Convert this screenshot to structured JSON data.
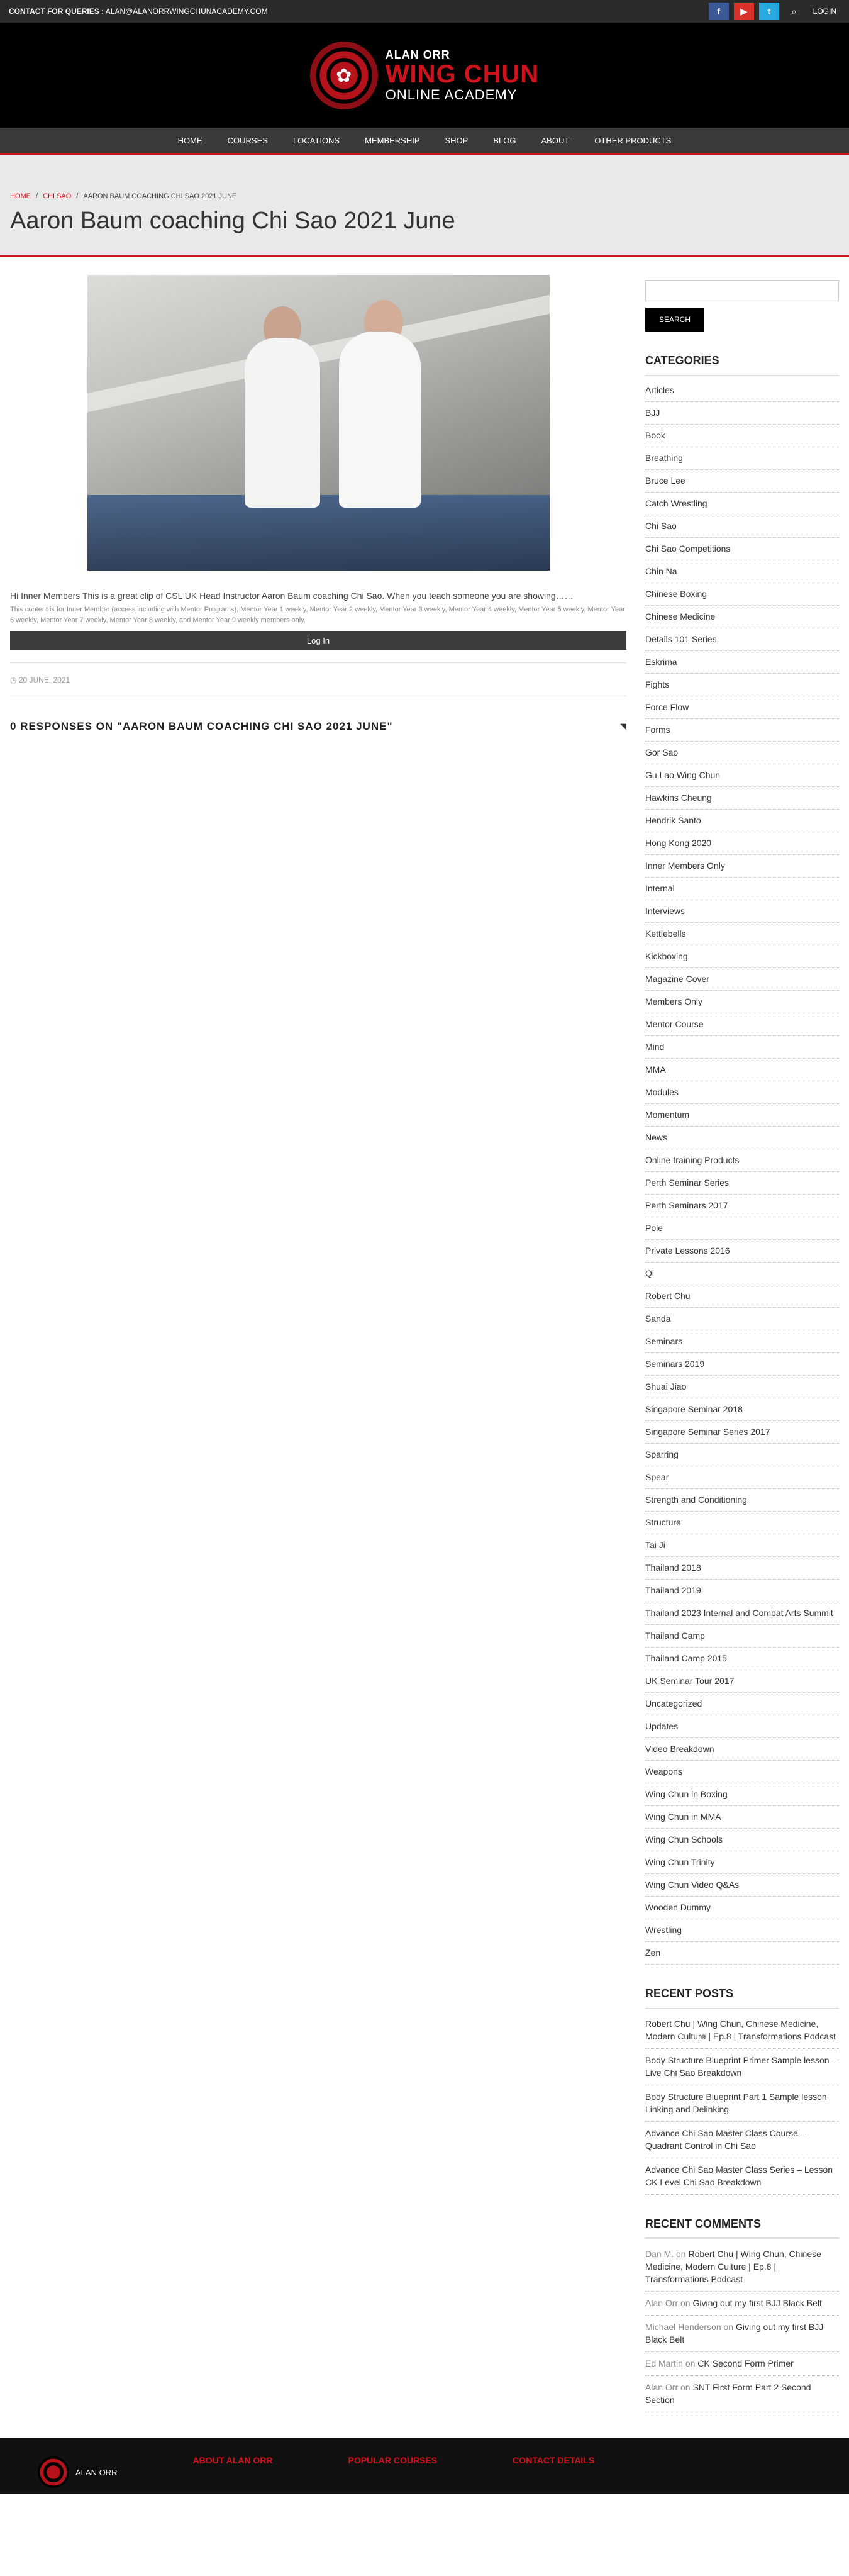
{
  "topbar": {
    "contact_label": "CONTACT FOR QUERIES :",
    "contact_email": "ALAN@ALANORRWINGCHUNACADEMY.COM",
    "login": "LOGIN"
  },
  "logo": {
    "line1": "ALAN ORR",
    "line2": "WING CHUN",
    "line3": "ONLINE ACADEMY"
  },
  "nav": [
    "HOME",
    "COURSES",
    "LOCATIONS",
    "MEMBERSHIP",
    "SHOP",
    "BLOG",
    "ABOUT",
    "OTHER PRODUCTS"
  ],
  "breadcrumb": [
    "HOME",
    "CHI SAO",
    "AARON BAUM COACHING CHI SAO 2021 JUNE"
  ],
  "page_title": "Aaron Baum coaching Chi Sao 2021 June",
  "post": {
    "excerpt": "Hi Inner Members This is a great clip of CSL UK Head Instructor Aaron Baum coaching Chi Sao. When you teach someone you are showing……",
    "members_note": "This content is for Inner Member (access including with Mentor Programs), Mentor Year 1 weekly, Mentor Year 2 weekly, Mentor Year 3 weekly, Mentor Year 4 weekly, Mentor Year 5 weekly, Mentor Year 6 weekly, Mentor Year 7 weekly, Mentor Year 8 weekly, and Mentor Year 9 weekly members only.",
    "login_button": "Log In",
    "date": "20 JUNE, 2021",
    "responses_title": "0 RESPONSES ON \"AARON BAUM COACHING CHI SAO 2021 JUNE\""
  },
  "sidebar": {
    "search_button": "SEARCH",
    "categories_title": "CATEGORIES",
    "categories": [
      "Articles",
      "BJJ",
      "Book",
      "Breathing",
      "Bruce Lee",
      "Catch Wrestling",
      "Chi Sao",
      "Chi Sao Competitions",
      "Chin Na",
      "Chinese Boxing",
      "Chinese Medicine",
      "Details 101 Series",
      "Eskrima",
      "Fights",
      "Force Flow",
      "Forms",
      "Gor Sao",
      "Gu Lao Wing Chun",
      "Hawkins Cheung",
      "Hendrik Santo",
      "Hong Kong 2020",
      "Inner Members Only",
      "Internal",
      "Interviews",
      "Kettlebells",
      "Kickboxing",
      "Magazine Cover",
      "Members Only",
      "Mentor Course",
      "Mind",
      "MMA",
      "Modules",
      "Momentum",
      "News",
      "Online training Products",
      "Perth Seminar Series",
      "Perth Seminars 2017",
      "Pole",
      "Private Lessons 2016",
      "Qi",
      "Robert Chu",
      "Sanda",
      "Seminars",
      "Seminars 2019",
      "Shuai Jiao",
      "Singapore Seminar 2018",
      "Singapore Seminar Series 2017",
      "Sparring",
      "Spear",
      "Strength and Conditioning",
      "Structure",
      "Tai Ji",
      "Thailand 2018",
      "Thailand 2019",
      "Thailand 2023 Internal and Combat Arts Summit",
      "Thailand Camp",
      "Thailand Camp 2015",
      "UK Seminar Tour 2017",
      "Uncategorized",
      "Updates",
      "Video Breakdown",
      "Weapons",
      "Wing Chun in Boxing",
      "Wing Chun in MMA",
      "Wing Chun Schools",
      "Wing Chun Trinity",
      "Wing Chun Video Q&As",
      "Wooden Dummy",
      "Wrestling",
      "Zen"
    ],
    "recent_posts_title": "RECENT POSTS",
    "recent_posts": [
      "Robert Chu | Wing Chun, Chinese Medicine, Modern Culture | Ep.8 | Transformations Podcast",
      "Body Structure Blueprint Primer Sample lesson – Live Chi Sao Breakdown",
      "Body Structure Blueprint Part 1 Sample lesson Linking and Delinking",
      "Advance Chi Sao Master Class Course – Quadrant Control in Chi Sao",
      "Advance Chi Sao Master Class Series – Lesson CK Level Chi Sao Breakdown"
    ],
    "recent_comments_title": "RECENT COMMENTS",
    "recent_comments": [
      {
        "author": "Dan M.",
        "on": "on",
        "post": "Robert Chu | Wing Chun, Chinese Medicine, Modern Culture | Ep.8 | Transformations Podcast"
      },
      {
        "author": "Alan Orr",
        "on": "on",
        "post": "Giving out my first BJJ Black Belt"
      },
      {
        "author": "Michael Henderson",
        "on": "on",
        "post": "Giving out my first BJJ Black Belt"
      },
      {
        "author": "Ed Martin",
        "on": "on",
        "post": "CK Second Form Primer"
      },
      {
        "author": "Alan Orr",
        "on": "on",
        "post": "SNT First Form Part 2 Second Section"
      }
    ]
  },
  "footer": {
    "logo_text": "ALAN ORR",
    "col1": "ABOUT ALAN ORR",
    "col2": "POPULAR COURSES",
    "col3": "CONTACT DETAILS"
  },
  "colors": {
    "accent": "#d0121d",
    "topbar": "#2b2b2b",
    "nav": "#3a3a3a"
  }
}
